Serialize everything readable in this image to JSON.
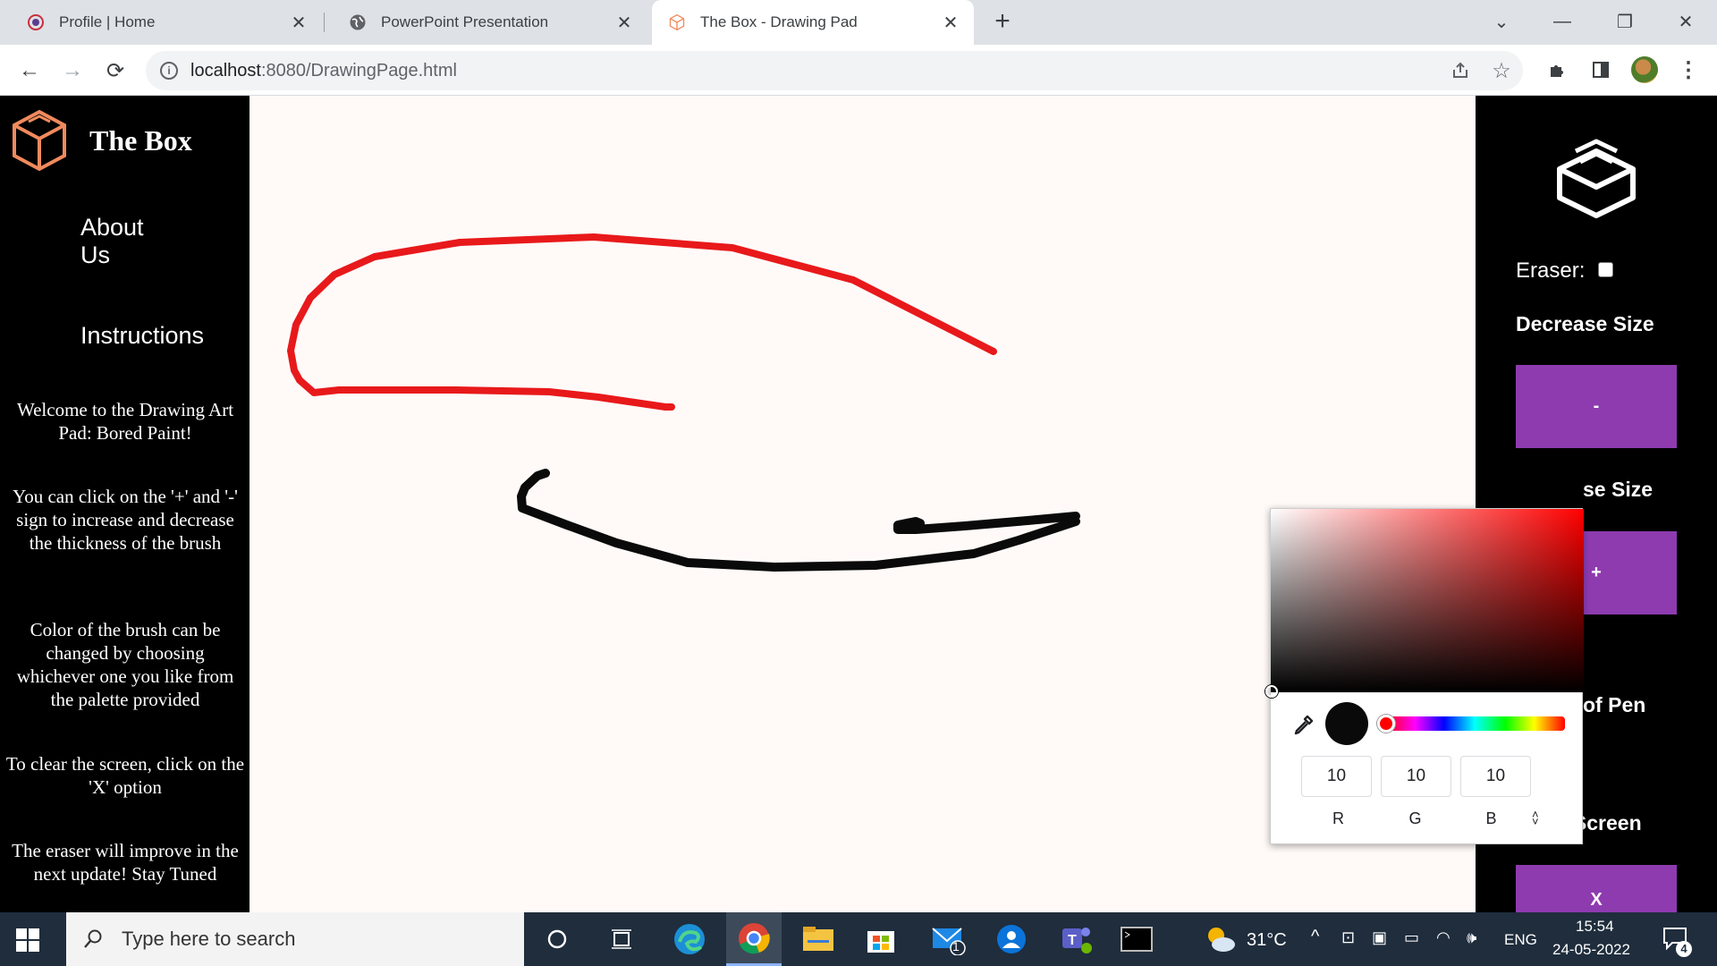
{
  "browser": {
    "tabs": [
      {
        "title": "Profile | Home",
        "active": false
      },
      {
        "title": "PowerPoint Presentation",
        "active": false
      },
      {
        "title": "The Box - Drawing Pad",
        "active": true
      }
    ],
    "url_host": "localhost",
    "url_path": ":8080/DrawingPage.html"
  },
  "left_panel": {
    "brand_title": "The Box",
    "nav": [
      "About Us",
      "Instructions"
    ],
    "paragraphs": [
      "Welcome to the Drawing Art Pad: Bored Paint!",
      "You can click on the '+' and '-' sign to increase and decrease the thickness of the brush",
      "Color of the brush can be changed by choosing whichever one you like from the palette provided",
      "To clear the screen, click on the 'X' option",
      "The eraser will improve in the next update! Stay Tuned"
    ]
  },
  "right_panel": {
    "eraser_label": "Eraser:",
    "eraser_checked": false,
    "decrease_label": "Decrease Size",
    "decrease_btn": "-",
    "increase_label_visible": "se Size",
    "increase_btn": "+",
    "color_label_visible": "of Pen",
    "pen_color": "#0a0a0a",
    "clear_label": "Clear Screen",
    "clear_btn": "X"
  },
  "color_picker": {
    "hue_color": "#ff0000",
    "r": "10",
    "g": "10",
    "b": "10",
    "r_label": "R",
    "g_label": "G",
    "b_label": "B"
  },
  "strokes": [
    {
      "color": "#e8191b",
      "name": "red-stroke"
    },
    {
      "color": "#0a0a0a",
      "name": "black-stroke"
    }
  ],
  "taskbar": {
    "search_placeholder": "Type here to search",
    "weather": "31°C",
    "language": "ENG",
    "time": "15:54",
    "date": "24-05-2022",
    "mail_badge": "1",
    "notification_count": "4"
  },
  "colors": {
    "accent_purple": "#8e3bb0",
    "brand_orange": "#f08a5d"
  }
}
